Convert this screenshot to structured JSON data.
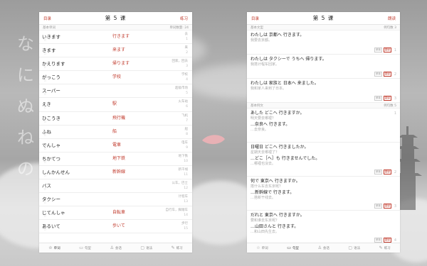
{
  "background": {
    "kana": [
      "な",
      "に",
      "ぬ",
      "ね",
      "の"
    ]
  },
  "left": {
    "back_label": "目录",
    "title": "第 5 课",
    "practice_label": "练习",
    "section_label": "基本单词",
    "section_hint": "单词数量: 24",
    "rows": [
      {
        "kana": "いきます",
        "kanji": "行きます",
        "meaning": "去",
        "num": "1"
      },
      {
        "kana": "きます",
        "kanji": "来ます",
        "meaning": "来",
        "num": "2"
      },
      {
        "kana": "かえります",
        "kanji": "帰ります",
        "meaning": "回家，回去",
        "num": "3"
      },
      {
        "kana": "がっこう",
        "kanji": "学校",
        "meaning": "学校",
        "num": "4"
      },
      {
        "kana": "スーパー",
        "kanji": "",
        "meaning": "超级市场",
        "num": "5"
      },
      {
        "kana": "えき",
        "kanji": "駅",
        "meaning": "火车站",
        "num": "6"
      },
      {
        "kana": "ひこうき",
        "kanji": "飛行機",
        "meaning": "飞机",
        "num": "7"
      },
      {
        "kana": "ふね",
        "kanji": "船",
        "meaning": "船",
        "num": "8"
      },
      {
        "kana": "でんしゃ",
        "kanji": "電車",
        "meaning": "电车",
        "num": "9"
      },
      {
        "kana": "ちかてつ",
        "kanji": "地下鉄",
        "meaning": "地下铁",
        "num": "10"
      },
      {
        "kana": "しんかんせん",
        "kanji": "新幹線",
        "meaning": "新干线",
        "num": "11"
      },
      {
        "kana": "バス",
        "kanji": "",
        "meaning": "公车，巴士",
        "num": "12"
      },
      {
        "kana": "タクシー",
        "kanji": "",
        "meaning": "计程车",
        "num": "13"
      },
      {
        "kana": "じてんしゃ",
        "kanji": "自転車",
        "meaning": "自行车，脚踏车",
        "num": "14"
      },
      {
        "kana": "あるいて",
        "kanji": "歩いて",
        "meaning": "步行",
        "num": "15"
      }
    ],
    "tabs": [
      {
        "icon": "☆",
        "label": "单词"
      },
      {
        "icon": "▭",
        "label": "句型"
      },
      {
        "icon": "♙",
        "label": "会话"
      },
      {
        "icon": "▢",
        "label": "语法"
      },
      {
        "icon": "✎",
        "label": "练习"
      }
    ]
  },
  "right": {
    "back_label": "目录",
    "title": "第 5 课",
    "practice_label": "朗读",
    "section1_label": "基本文型",
    "section1_hint": "例句数",
    "section1_count": "3",
    "patterns": [
      {
        "jp": "わたしは 京都へ 行きます。",
        "cn": "我要去京都。",
        "num": "1"
      },
      {
        "jp": "わたしは タクシーで うちへ 帰ります。",
        "cn": "我搭计程车回家。",
        "num": "2"
      },
      {
        "jp": "わたしは 家族と 日本へ 来ました。",
        "cn": "我和家人来到了日本。",
        "num": "3"
      }
    ],
    "section2_label": "基本例文",
    "section2_hint": "例句数",
    "section2_count": "5",
    "examples": [
      {
        "q": "あした どこへ 行きますか。",
        "qcn": "明天要去哪裡？",
        "a": "…奈良へ 行きます。",
        "acn": "…去奈良。",
        "num": "1"
      },
      {
        "q": "日曜日 どこへ 行きましたか。",
        "qcn": "星期天去哪裡了？",
        "a": "…どこ［へ］も 行きませんでした。",
        "acn": "…哪裡也沒去。",
        "num": "2"
      },
      {
        "q": "何で 東京へ 行きますか。",
        "qcn": "搭什么车去东京呢？",
        "a": "…新幹線で 行きます。",
        "acn": "…搭新干线去。",
        "num": "3"
      },
      {
        "q": "だれと 東京へ 行きますか。",
        "qcn": "要和谁去东京呢？",
        "a": "…山田さんと 行きます。",
        "acn": "…和山田先生去。",
        "num": "4"
      }
    ],
    "badge_a": "朗读",
    "badge_b": "翻译",
    "tabs": [
      {
        "icon": "☆",
        "label": "单词"
      },
      {
        "icon": "▭",
        "label": "句型"
      },
      {
        "icon": "♙",
        "label": "会话"
      },
      {
        "icon": "▢",
        "label": "语法"
      },
      {
        "icon": "✎",
        "label": "练习"
      }
    ]
  }
}
